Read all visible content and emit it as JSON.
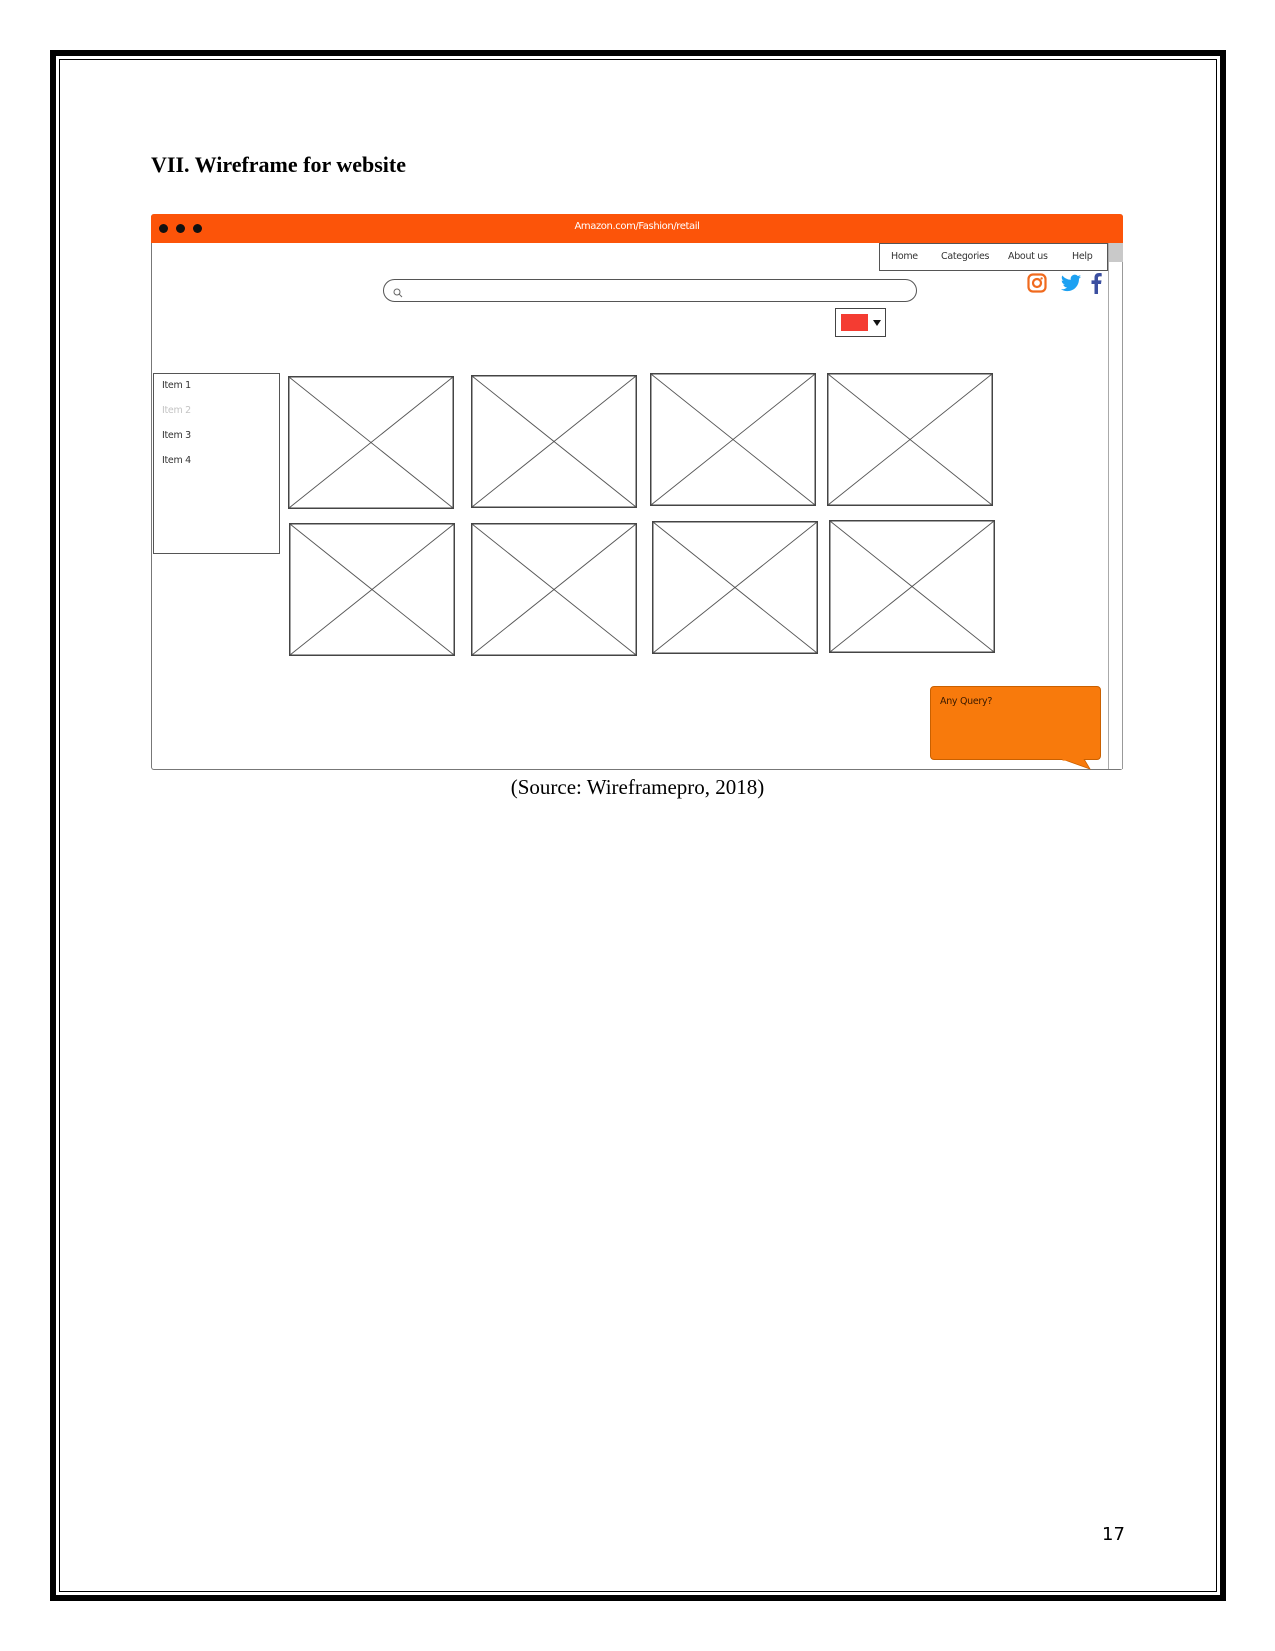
{
  "document": {
    "section_title": "VII. Wireframe for website",
    "caption": "(Source: Wireframepro, 2018)",
    "page_number": "17"
  },
  "wireframe": {
    "browser": {
      "url": "Amazon.com/Fashion/retail",
      "bar_color": "#fc5409",
      "window_dots": 3
    },
    "nav": {
      "items": [
        {
          "label": "Home"
        },
        {
          "label": "Categories"
        },
        {
          "label": "About us"
        },
        {
          "label": "Help"
        }
      ]
    },
    "social_icons": [
      "instagram-icon",
      "twitter-icon",
      "facebook-icon"
    ],
    "search": {
      "icon": "search-icon",
      "value": "",
      "placeholder": ""
    },
    "color_selector": {
      "selected_color": "#f43c32"
    },
    "sidebar": {
      "items": [
        {
          "label": "Item 1",
          "state": "normal"
        },
        {
          "label": "Item 2",
          "state": "disabled"
        },
        {
          "label": "Item 3",
          "state": "normal"
        },
        {
          "label": "Item 4",
          "state": "normal"
        }
      ]
    },
    "image_placeholders": 8,
    "chat_bubble": {
      "text": "Any Query?",
      "color": "#f87a0c"
    }
  }
}
